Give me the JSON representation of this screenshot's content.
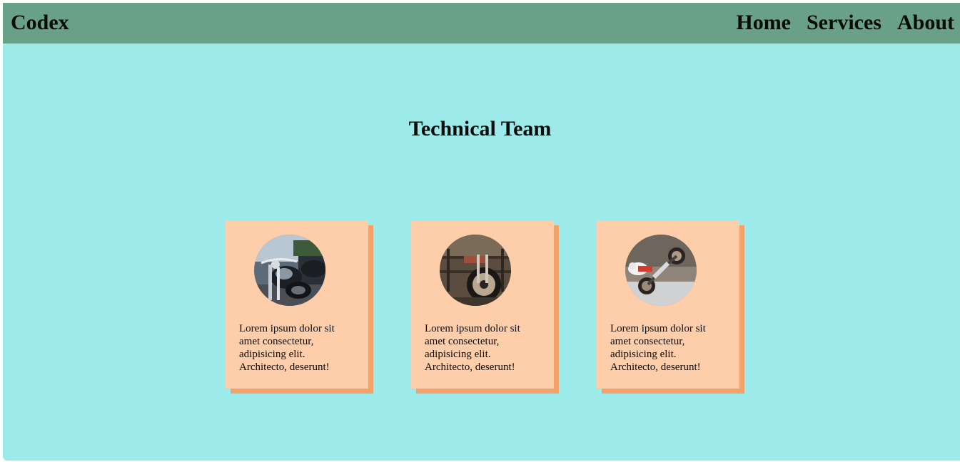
{
  "navbar": {
    "brand": "Codex",
    "links": [
      "Home",
      "Services",
      "About"
    ]
  },
  "main": {
    "title": "Technical Team",
    "cards": [
      {
        "image": "motorcycle-cruiser-photo",
        "text": "Lorem ipsum dolor sit amet consectetur, adipisicing elit. Architecto, deserunt!"
      },
      {
        "image": "motorcycle-garage-photo",
        "text": "Lorem ipsum dolor sit amet consectetur, adipisicing elit. Architecto, deserunt!"
      },
      {
        "image": "motocross-wheelie-photo",
        "text": "Lorem ipsum dolor sit amet consectetur, adipisicing elit. Architecto, deserunt!"
      }
    ]
  },
  "colors": {
    "navbar": "#69a088",
    "background": "#9cebea",
    "card": "#fecdaa",
    "card_shadow": "#f1a36b"
  }
}
